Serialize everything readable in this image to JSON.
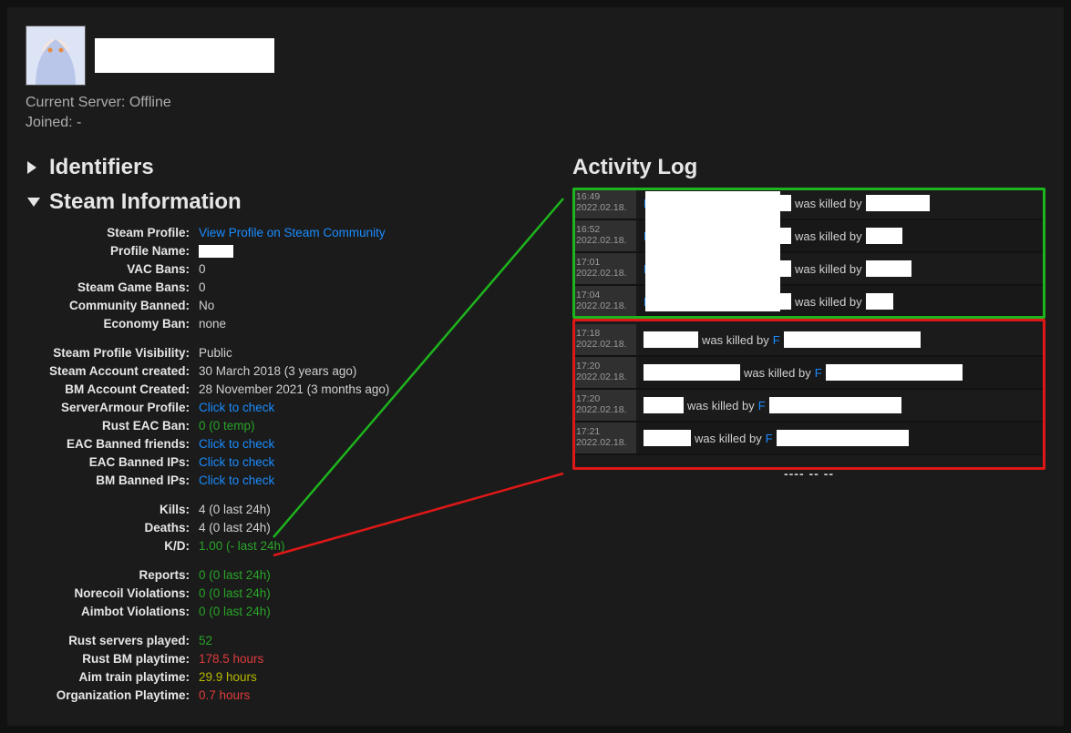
{
  "header": {
    "current_server_label": "Current Server:",
    "current_server_value": "Offline",
    "joined_label": "Joined:",
    "joined_value": "-"
  },
  "sections": {
    "identifiers": "Identifiers",
    "steam_info": "Steam Information",
    "activity": "Activity Log"
  },
  "info": {
    "steam_profile_label": "Steam Profile:",
    "steam_profile_link": "View Profile on Steam Community",
    "profile_name_label": "Profile Name:",
    "vac_bans_label": "VAC Bans:",
    "vac_bans_value": "0",
    "game_bans_label": "Steam Game Bans:",
    "game_bans_value": "0",
    "community_banned_label": "Community Banned:",
    "community_banned_value": "No",
    "economy_ban_label": "Economy Ban:",
    "economy_ban_value": "none",
    "visibility_label": "Steam Profile Visibility:",
    "visibility_value": "Public",
    "steam_created_label": "Steam Account created:",
    "steam_created_value": "30 March 2018 (3 years ago)",
    "bm_created_label": "BM Account Created:",
    "bm_created_value": "28 November 2021 (3 months ago)",
    "server_armour_label": "ServerArmour Profile:",
    "click_to_check": "Click to check",
    "rust_eac_label": "Rust EAC Ban:",
    "rust_eac_value": "0 (0 temp)",
    "eac_friends_label": "EAC Banned friends:",
    "eac_ips_label": "EAC Banned IPs:",
    "bm_ips_label": "BM Banned IPs:",
    "kills_label": "Kills:",
    "kills_value": "4 (0 last 24h)",
    "deaths_label": "Deaths:",
    "deaths_value": "4 (0 last 24h)",
    "kd_label": "K/D:",
    "kd_value": "1.00 (- last 24h)",
    "reports_label": "Reports:",
    "reports_value": "0 (0 last 24h)",
    "norecoil_label": "Norecoil Violations:",
    "norecoil_value": "0 (0 last 24h)",
    "aimbot_label": "Aimbot Violations:",
    "aimbot_value": "0 (0 last 24h)",
    "servers_played_label": "Rust servers played:",
    "servers_played_value": "52",
    "bm_playtime_label": "Rust BM playtime:",
    "bm_playtime_value": "178.5 hours",
    "aim_playtime_label": "Aim train playtime:",
    "aim_playtime_value": "29.9 hours",
    "org_playtime_label": "Organization Playtime:",
    "org_playtime_value": "0.7 hours"
  },
  "activity": {
    "was_killed_by": "was killed by",
    "rows": [
      {
        "time": "16:49",
        "date": "2022.02.18.",
        "mode": "victim",
        "w1": 150,
        "w2": 70
      },
      {
        "time": "16:52",
        "date": "2022.02.18.",
        "mode": "victim",
        "w1": 150,
        "w2": 40
      },
      {
        "time": "17:01",
        "date": "2022.02.18.",
        "mode": "victim",
        "w1": 150,
        "w2": 50
      },
      {
        "time": "17:04",
        "date": "2022.02.18.",
        "mode": "victim",
        "w1": 150,
        "w2": 30
      },
      {
        "time": "17:18",
        "date": "2022.02.18.",
        "mode": "killer",
        "w1": 60,
        "w2": 150
      },
      {
        "time": "17:20",
        "date": "2022.02.18.",
        "mode": "killer",
        "w1": 106,
        "w2": 150
      },
      {
        "time": "17:20",
        "date": "2022.02.18.",
        "mode": "killer",
        "w1": 44,
        "w2": 145
      },
      {
        "time": "17:21",
        "date": "2022.02.18.",
        "mode": "killer",
        "w1": 52,
        "w2": 145
      }
    ],
    "mid_date": "---- -- --"
  }
}
